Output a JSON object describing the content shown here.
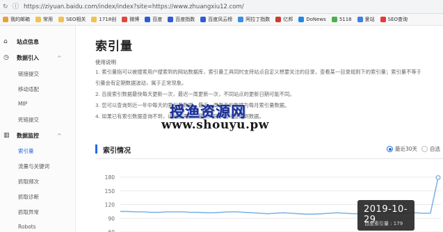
{
  "browser": {
    "url": "https://ziyuan.baidu.com/index/index?site=https://www.zhuangxiu12.com/",
    "bookmarks": [
      {
        "label": "我的邮箱",
        "color": "#e8a13a"
      },
      {
        "label": "常用",
        "color": "#f2c14e"
      },
      {
        "label": "SEO相关",
        "color": "#f2c14e"
      },
      {
        "label": "1718创",
        "color": "#f2c14e"
      },
      {
        "label": "微博",
        "color": "#e0483e"
      },
      {
        "label": "百度",
        "color": "#2f5bd6"
      },
      {
        "label": "百度指数",
        "color": "#2f5bd6"
      },
      {
        "label": "百度风云榜",
        "color": "#2f5bd6"
      },
      {
        "label": "阿拉丁指数",
        "color": "#3a8ee6"
      },
      {
        "label": "亿邦",
        "color": "#d03a2f"
      },
      {
        "label": "DoNews",
        "color": "#1e88e5"
      },
      {
        "label": "5118",
        "color": "#4caf50"
      },
      {
        "label": "爱站",
        "color": "#3f7fe0"
      },
      {
        "label": "SEO查询",
        "color": "#e53935"
      }
    ]
  },
  "sidebar": {
    "groups": [
      {
        "label": "站点信息",
        "icon": "home-icon",
        "glyph": "⌂"
      },
      {
        "label": "数据引入",
        "icon": "upload-icon",
        "glyph": "◷",
        "chevron": "^"
      },
      {
        "label": "数据监控",
        "icon": "bar-chart-icon",
        "glyph": "▥",
        "chevron": "^"
      }
    ],
    "items_a": [
      "链接提交",
      "移动适配",
      "MIP",
      "死链提交"
    ],
    "items_b": [
      "索引量",
      "流量与关键词",
      "抓取频次",
      "抓取诊断",
      "抓取异常",
      "Robots"
    ]
  },
  "main": {
    "title": "索引量",
    "usage_title": "使用说明",
    "usage_lines": [
      "1. 索引量指可以被搜索用户搜索到的网站数据库，索引量工具同时支持站点自定义想要关注的目录，查看某一目录规则下的索引量；索引量不等于",
      "引量会有定期数据波动，属于正常现象。",
      "2. 百度索引数据最快每天更新一次，最迟一周更新一次，不同站点的更新日期可能不同。",
      "3. 您可以查询到近一年中每天的索引量数据，最近一周每天的数据为每月索引量数据。",
      "4. 如果已有索引数据查询不到，请稍后再查，最长间隔一周可查询到数据。"
    ],
    "watermark_line1": "授渔资源网",
    "watermark_line2": "www.shouyu.pw",
    "section_title": "索引情况",
    "radio_on": "最近30天",
    "radio_off": "自选"
  },
  "chart_data": {
    "type": "line",
    "y_ticks": [
      "180",
      "150",
      "120",
      "90",
      "60"
    ],
    "ylim": [
      60,
      180
    ],
    "series": [
      {
        "values": [
          105,
          105,
          104,
          104,
          103,
          103,
          104,
          104,
          104,
          103,
          103,
          102,
          102,
          103,
          104,
          104,
          103,
          102,
          101,
          100,
          101,
          102,
          101,
          100,
          99,
          99,
          100,
          101,
          102,
          101,
          100,
          100,
          101,
          102,
          103,
          102,
          101,
          101,
          102,
          101,
          101,
          179
        ]
      }
    ],
    "tooltip": {
      "date": "2019-10-29",
      "label": "百度索引量 : 179"
    }
  }
}
